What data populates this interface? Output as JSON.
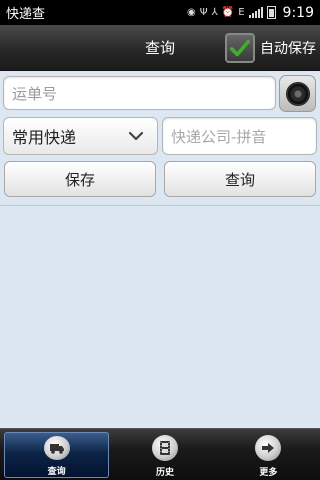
{
  "status_bar": {
    "app_name": "快递查",
    "time": "9:19",
    "icons": [
      "notification-icon",
      "usb-icon",
      "voicemail-icon",
      "alarm-icon",
      "data-icon",
      "signal-icon",
      "battery-icon"
    ]
  },
  "title_bar": {
    "title": "查询",
    "auto_save_label": "自动保存",
    "auto_save_checked": true
  },
  "form": {
    "tracking_placeholder": "运单号",
    "courier_select_value": "常用快递",
    "company_placeholder": "快递公司-拼音",
    "save_label": "保存",
    "query_label": "查询"
  },
  "tab_bar": {
    "tabs": [
      {
        "label": "查询",
        "icon": "truck-icon",
        "active": true
      },
      {
        "label": "历史",
        "icon": "film-icon",
        "active": false
      },
      {
        "label": "更多",
        "icon": "arrow-right-icon",
        "active": false
      }
    ]
  },
  "colors": {
    "background": "#dce7f2",
    "title_bar": "#262626",
    "checkmark": "#3fae2a",
    "active_tab": "#0d2447"
  }
}
